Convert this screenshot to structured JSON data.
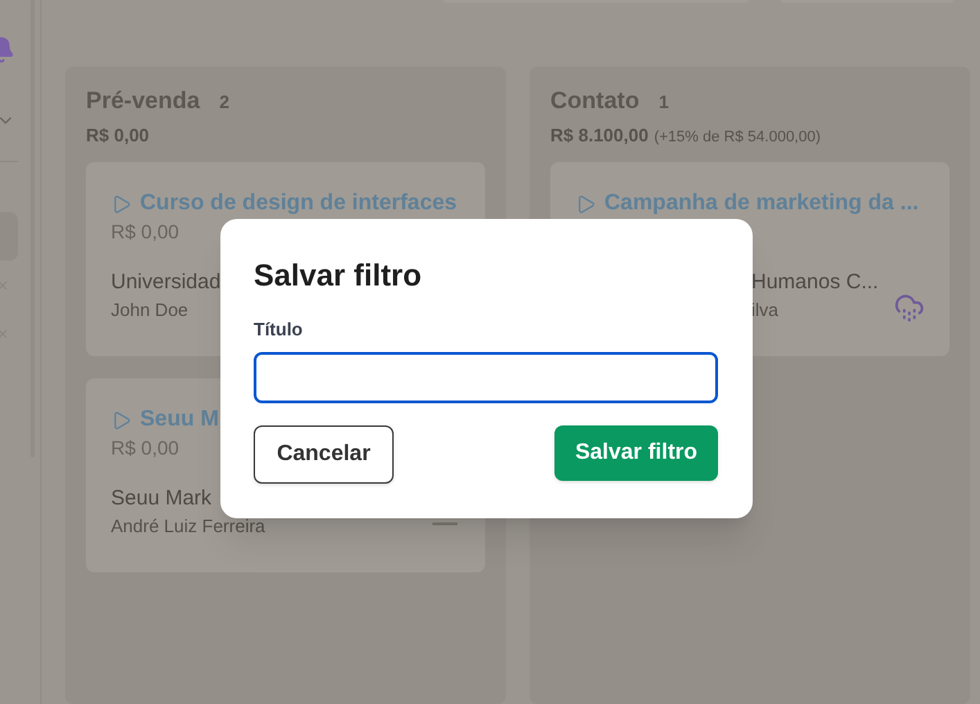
{
  "board": {
    "columns": [
      {
        "title": "Pré-venda",
        "count": "2",
        "amount": "R$ 0,00",
        "cards": [
          {
            "title": "Curso de design de interfaces",
            "value": "R$ 0,00",
            "company": "Universidad",
            "contact": "John Doe",
            "kind": "none",
            "hidden_start": false
          },
          {
            "title": "Seuu M",
            "value": "R$ 0,00",
            "company": "Seuu Mark",
            "contact": "André Luiz Ferreira",
            "kind": "dash",
            "hidden_start": false
          }
        ]
      },
      {
        "title": "Contato",
        "count": "1",
        "amount": "R$ 8.100,00",
        "amount_note": "(+15% de R$ 54.000,00)",
        "cards": [
          {
            "title": "Campanha de marketing da ...",
            "company": "Humanos C...",
            "contact": "ilva",
            "kind": "storm",
            "hidden_start": true
          }
        ]
      }
    ]
  },
  "dialog": {
    "title": "Salvar filtro",
    "field_label": "Título",
    "cancel": "Cancelar",
    "confirm": "Salvar filtro"
  }
}
